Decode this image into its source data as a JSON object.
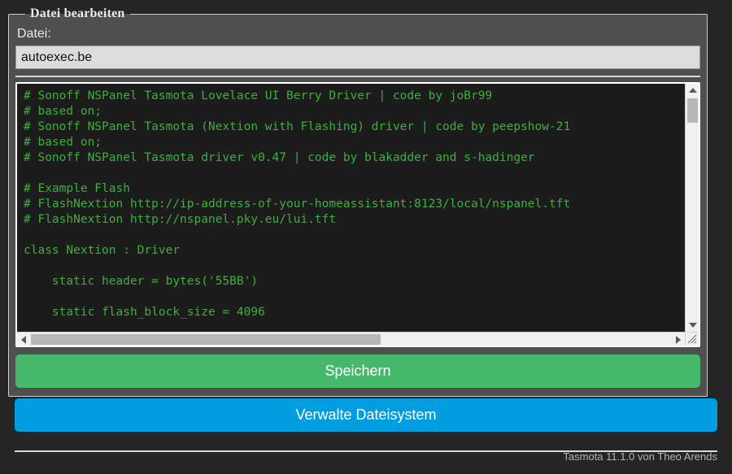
{
  "panel": {
    "legend": "Datei bearbeiten",
    "file_label": "Datei:",
    "file_input_value": "autoexec.be",
    "file_input_placeholder": "Datei"
  },
  "editor": {
    "lines": [
      "# Sonoff NSPanel Tasmota Lovelace UI Berry Driver | code by joBr99",
      "# based on;",
      "# Sonoff NSPanel Tasmota (Nextion with Flashing) driver | code by peepshow-21",
      "# based on;",
      "# Sonoff NSPanel Tasmota driver v0.47 | code by blakadder and s-hadinger",
      "",
      "# Example Flash",
      "# FlashNextion http://ip-address-of-your-homeassistant:8123/local/nspanel.tft",
      "# FlashNextion http://nspanel.pky.eu/lui.tft",
      "",
      "class Nextion : Driver",
      "",
      "    static header = bytes('55BB')",
      "",
      "    static flash_block_size = 4096"
    ],
    "text_color": "#3fae3f",
    "background_color": "#1c1c1c"
  },
  "buttons": {
    "save_label": "Speichern",
    "save_color": "#46b86b",
    "filesystem_label": "Verwalte Dateisystem",
    "filesystem_color": "#009ee0"
  },
  "footer": {
    "text": "Tasmota 11.1.0 von Theo Arends"
  }
}
